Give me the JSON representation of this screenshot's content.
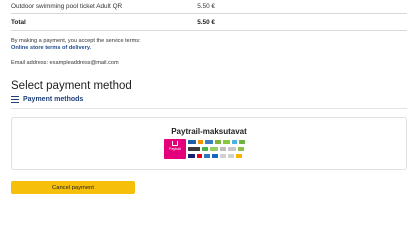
{
  "order": {
    "item_name": "Outdoor swimming pool ticket Adult QR",
    "item_price": "5.50 €",
    "total_label": "Total",
    "total_price": "5.50 €"
  },
  "terms": {
    "text": "By making a payment, you accept the service terms:",
    "link_label": "Online store terms of delivery."
  },
  "email": {
    "line": "Email address: exampleaddress@mail.com"
  },
  "payment": {
    "section_title": "Select payment method",
    "methods_heading": "Payment methods",
    "methods_icon": "list-icon",
    "provider": {
      "title": "Paytrail-maksutavat",
      "logo_text": "Paytrail",
      "logo_color": "#e3007a"
    }
  },
  "actions": {
    "cancel_label": "Cancel payment",
    "cancel_color": "#f5bf0a"
  }
}
